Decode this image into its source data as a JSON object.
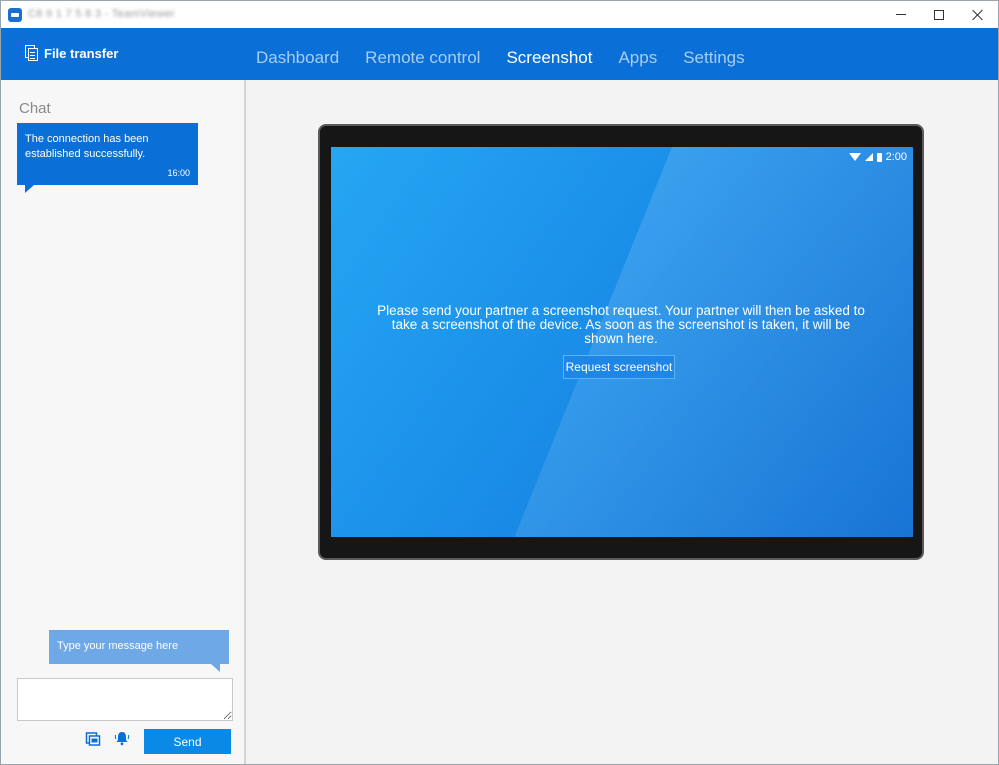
{
  "window": {
    "title": "C8 9 1 7 5 8 3 - TeamViewer"
  },
  "nav": {
    "file_transfer": "File transfer",
    "tabs": [
      {
        "label": "Dashboard",
        "active": false
      },
      {
        "label": "Remote control",
        "active": false
      },
      {
        "label": "Screenshot",
        "active": true
      },
      {
        "label": "Apps",
        "active": false
      },
      {
        "label": "Settings",
        "active": false
      }
    ]
  },
  "chat": {
    "title": "Chat",
    "messages": [
      {
        "text": "The connection has been established successfully.",
        "time": "16:00"
      }
    ],
    "hint": "Type your message here",
    "input_value": "",
    "send_label": "Send"
  },
  "device": {
    "status_time": "2:00",
    "message": "Please send your partner a screenshot request. Your partner will then be asked to take a screenshot of the device. As soon as the screenshot is taken, it will be shown here.",
    "request_button": "Request screenshot"
  },
  "colors": {
    "brand_blue": "#0a6fd6",
    "tab_inactive": "#a9cdf3",
    "send_button": "#0a8ae6"
  }
}
